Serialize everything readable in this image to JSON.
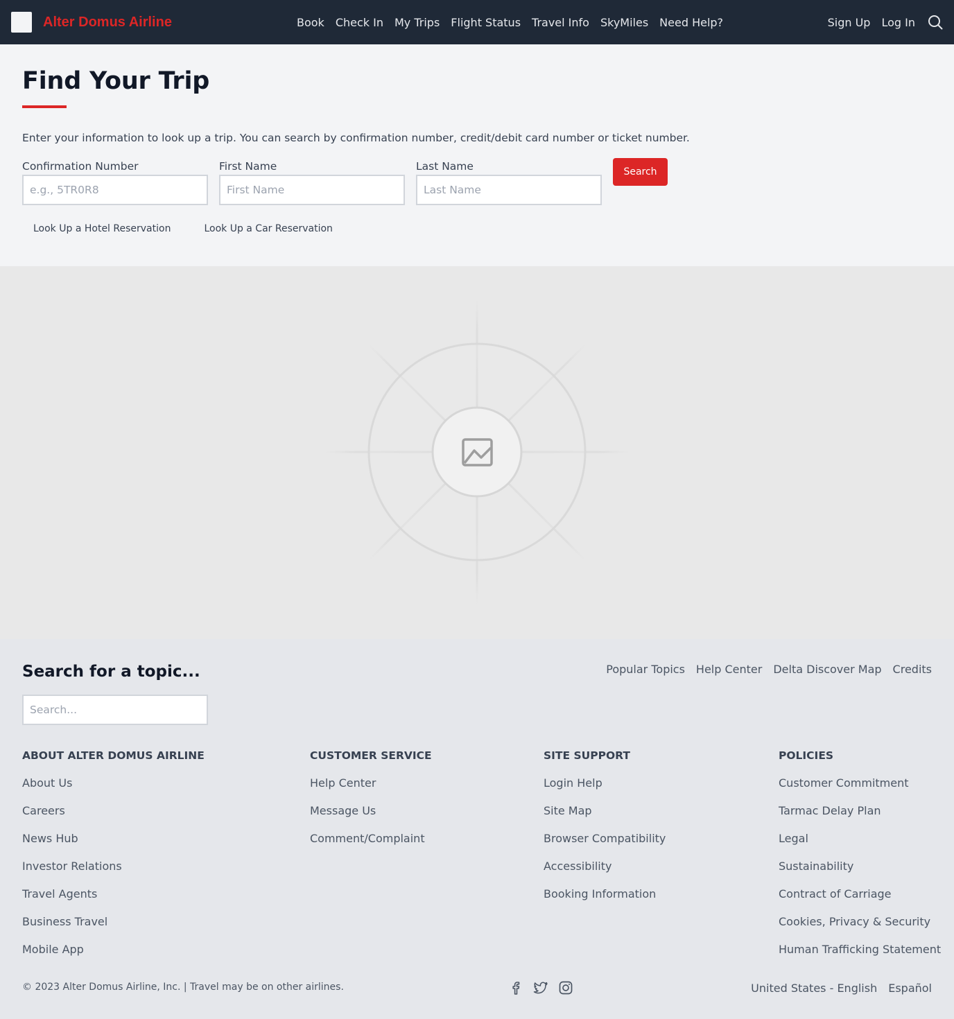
{
  "header": {
    "brand": "Alter Domus Airline",
    "nav": [
      "Book",
      "Check In",
      "My Trips",
      "Flight Status",
      "Travel Info",
      "SkyMiles",
      "Need Help?"
    ],
    "sign_up": "Sign Up",
    "log_in": "Log In"
  },
  "trip": {
    "title": "Find Your Trip",
    "intro": "Enter your information to look up a trip. You can search by confirmation number, credit/debit card number or ticket number.",
    "confirmation_label": "Confirmation Number",
    "confirmation_placeholder": "e.g., 5TR0R8",
    "first_name_label": "First Name",
    "first_name_placeholder": "First Name",
    "last_name_label": "Last Name",
    "last_name_placeholder": "Last Name",
    "search_button": "Search",
    "hotel_lookup": "Look Up a Hotel Reservation",
    "car_lookup": "Look Up a Car Reservation"
  },
  "footer": {
    "topic_title": "Search for a topic...",
    "topic_placeholder": "Search...",
    "topic_links": [
      "Popular Topics",
      "Help Center",
      "Delta Discover Map",
      "Credits"
    ],
    "columns": [
      {
        "heading": "ABOUT ALTER DOMUS AIRLINE",
        "links": [
          "About Us",
          "Careers",
          "News Hub",
          "Investor Relations",
          "Travel Agents",
          "Business Travel",
          "Mobile App"
        ]
      },
      {
        "heading": "CUSTOMER SERVICE",
        "links": [
          "Help Center",
          "Message Us",
          "Comment/Complaint"
        ]
      },
      {
        "heading": "SITE SUPPORT",
        "links": [
          "Login Help",
          "Site Map",
          "Browser Compatibility",
          "Accessibility",
          "Booking Information"
        ]
      },
      {
        "heading": "POLICIES",
        "links": [
          "Customer Commitment",
          "Tarmac Delay Plan",
          "Legal",
          "Sustainability",
          "Contract of Carriage",
          "Cookies, Privacy & Security",
          "Human Trafficking Statement"
        ]
      }
    ],
    "copyright": "© 2023 Alter Domus Airline, Inc. | Travel may be on other airlines.",
    "social_icons": [
      "facebook-icon",
      "twitter-icon",
      "instagram-icon"
    ],
    "locale": "United States - English",
    "spanish": "Español"
  },
  "colors": {
    "nav_bg": "#1f2937",
    "accent": "#dc2626"
  }
}
